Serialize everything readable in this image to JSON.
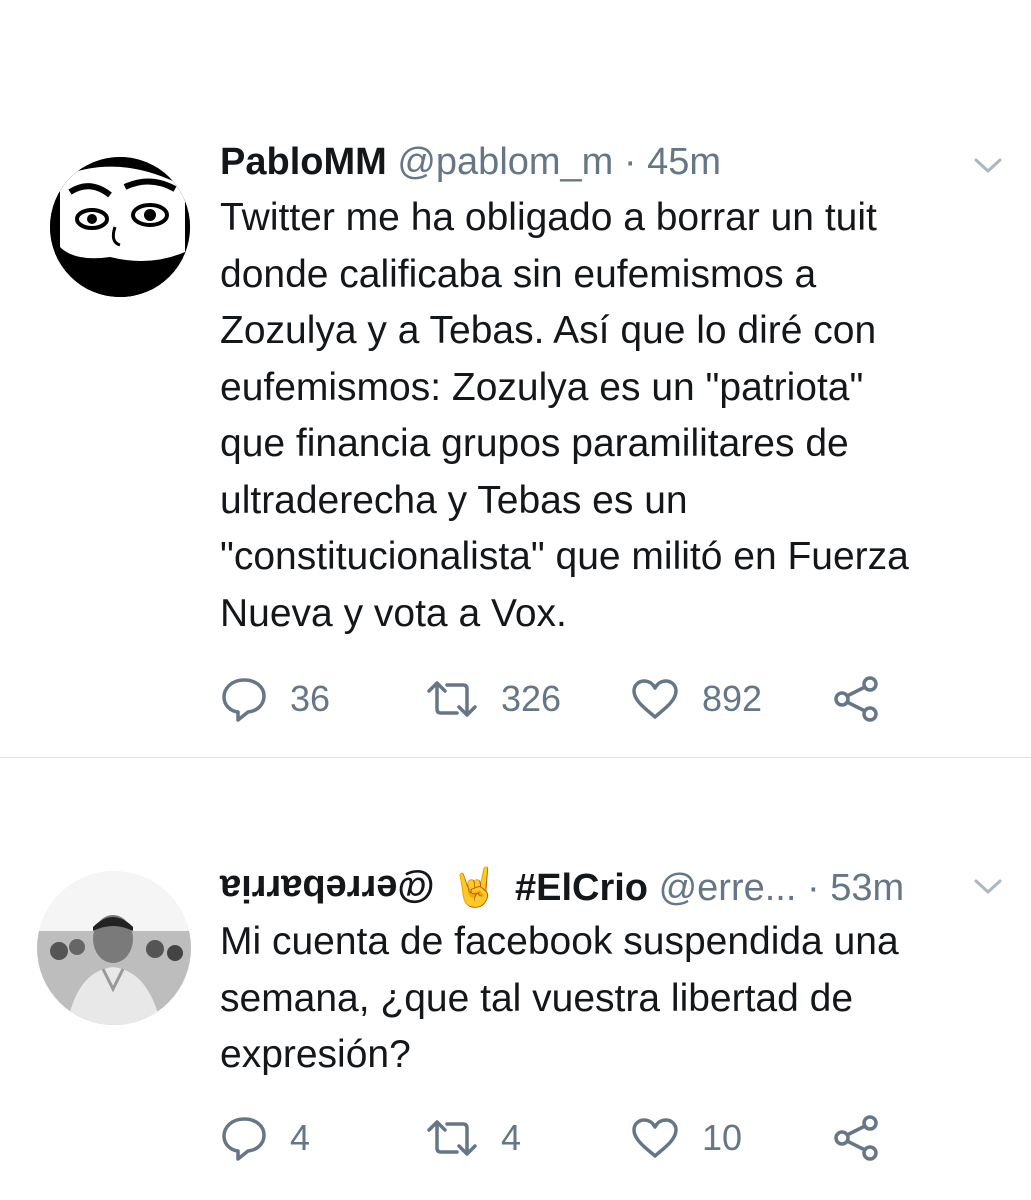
{
  "tweets": [
    {
      "display_name": "PabloMM",
      "handle": "@pablom_m",
      "separator": "·",
      "time": "45m",
      "text": "Twitter me ha obligado a borrar un tuit\ndonde calificaba sin eufemismos a\nZozulya y a Tebas. Así que lo diré con\neufemismos: Zozulya es un \"patriota\"\nque financia grupos paramilitares de\nultraderecha y Tebas es un\n\"constitucionalista\" que militó en Fuerza\nNueva y vota a Vox.",
      "replies": "36",
      "retweets": "326",
      "likes": "892"
    },
    {
      "display_name_flipped": "@errebarria",
      "emoji_icon": "sign-of-the-horns-icon",
      "display_name": "#ElCrio",
      "handle": "@erre...",
      "separator": "·",
      "time": "53m",
      "text": "Mi cuenta de facebook suspendida una\nsemana, ¿que tal vuestra libertad de\nexpresión?",
      "replies": "4",
      "retweets": "4",
      "likes": "10"
    }
  ],
  "colors": {
    "text_primary": "#14171a",
    "text_secondary": "#657786",
    "divider": "#dfe3e6",
    "icon": "#657786"
  }
}
